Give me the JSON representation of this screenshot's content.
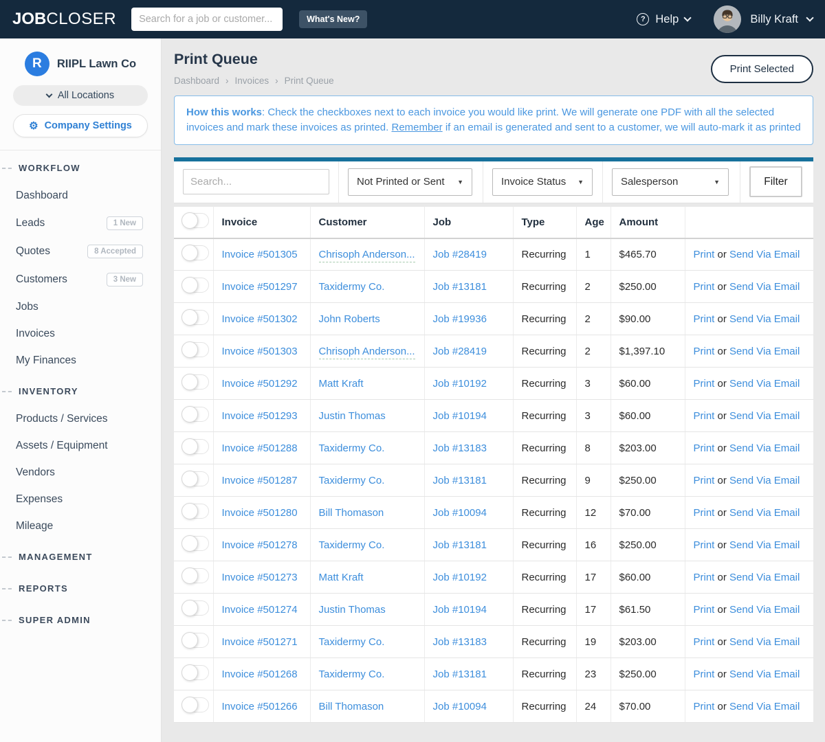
{
  "navbar": {
    "logo_bold": "JOB",
    "logo_light": "CLOSER",
    "search_placeholder": "Search for a job or customer...",
    "whats_new": "What's New?",
    "help": "Help",
    "help_icon_glyph": "?",
    "user_name": "Billy Kraft"
  },
  "sidebar": {
    "company": {
      "initial": "R",
      "name": "RIIPL Lawn Co"
    },
    "locations_label": "All Locations",
    "company_settings_label": "Company Settings",
    "gear_icon_glyph": "⚙",
    "sections": [
      {
        "label": "WORKFLOW",
        "items": [
          {
            "label": "Dashboard"
          },
          {
            "label": "Leads",
            "badge": "1 New"
          },
          {
            "label": "Quotes",
            "badge": "8 Accepted"
          },
          {
            "label": "Customers",
            "badge": "3 New"
          },
          {
            "label": "Jobs"
          },
          {
            "label": "Invoices"
          },
          {
            "label": "My Finances"
          }
        ]
      },
      {
        "label": "INVENTORY",
        "items": [
          {
            "label": "Products / Services"
          },
          {
            "label": "Assets / Equipment"
          },
          {
            "label": "Vendors"
          },
          {
            "label": "Expenses"
          },
          {
            "label": "Mileage"
          }
        ]
      },
      {
        "label": "MANAGEMENT",
        "items": []
      },
      {
        "label": "REPORTS",
        "items": []
      },
      {
        "label": "SUPER ADMIN",
        "items": []
      }
    ]
  },
  "header": {
    "title": "Print Queue",
    "breadcrumb": [
      "Dashboard",
      "Invoices",
      "Print Queue"
    ],
    "print_selected_label": "Print Selected"
  },
  "info_box": {
    "bold": "How this works",
    "text_1": ": Check the checkboxes next to each invoice you would like print. We will generate one PDF with all the selected invoices and mark these invoices as printed. ",
    "underline": "Remember",
    "text_2": " if an email is generated and sent to a customer, we will auto-mark it as printed"
  },
  "filters": {
    "search_placeholder": "Search...",
    "selects": [
      "Not Printed or Sent",
      "Invoice Status",
      "Salesperson"
    ],
    "caret_glyph": "▼",
    "filter_button_label": "Filter"
  },
  "table": {
    "columns": [
      "Invoice",
      "Customer",
      "Job",
      "Type",
      "Age",
      "Amount"
    ],
    "action_print": "Print",
    "action_or": "or",
    "action_email": "Send Via Email",
    "rows": [
      {
        "invoice": "Invoice #501305",
        "customer": "Chrisoph Anderson...",
        "job": "Job #28419",
        "type": "Recurring",
        "age": "1",
        "amount": "$465.70"
      },
      {
        "invoice": "Invoice #501297",
        "customer": "Taxidermy Co.",
        "job": "Job #13181",
        "type": "Recurring",
        "age": "2",
        "amount": "$250.00"
      },
      {
        "invoice": "Invoice #501302",
        "customer": "John Roberts",
        "job": "Job #19936",
        "type": "Recurring",
        "age": "2",
        "amount": "$90.00"
      },
      {
        "invoice": "Invoice #501303",
        "customer": "Chrisoph Anderson...",
        "job": "Job #28419",
        "type": "Recurring",
        "age": "2",
        "amount": "$1,397.10"
      },
      {
        "invoice": "Invoice #501292",
        "customer": "Matt Kraft",
        "job": "Job #10192",
        "type": "Recurring",
        "age": "3",
        "amount": "$60.00"
      },
      {
        "invoice": "Invoice #501293",
        "customer": "Justin Thomas",
        "job": "Job #10194",
        "type": "Recurring",
        "age": "3",
        "amount": "$60.00"
      },
      {
        "invoice": "Invoice #501288",
        "customer": "Taxidermy Co.",
        "job": "Job #13183",
        "type": "Recurring",
        "age": "8",
        "amount": "$203.00"
      },
      {
        "invoice": "Invoice #501287",
        "customer": "Taxidermy Co.",
        "job": "Job #13181",
        "type": "Recurring",
        "age": "9",
        "amount": "$250.00"
      },
      {
        "invoice": "Invoice #501280",
        "customer": "Bill Thomason",
        "job": "Job #10094",
        "type": "Recurring",
        "age": "12",
        "amount": "$70.00"
      },
      {
        "invoice": "Invoice #501278",
        "customer": "Taxidermy Co.",
        "job": "Job #13181",
        "type": "Recurring",
        "age": "16",
        "amount": "$250.00"
      },
      {
        "invoice": "Invoice #501273",
        "customer": "Matt Kraft",
        "job": "Job #10192",
        "type": "Recurring",
        "age": "17",
        "amount": "$60.00"
      },
      {
        "invoice": "Invoice #501274",
        "customer": "Justin Thomas",
        "job": "Job #10194",
        "type": "Recurring",
        "age": "17",
        "amount": "$61.50"
      },
      {
        "invoice": "Invoice #501271",
        "customer": "Taxidermy Co.",
        "job": "Job #13183",
        "type": "Recurring",
        "age": "19",
        "amount": "$203.00"
      },
      {
        "invoice": "Invoice #501268",
        "customer": "Taxidermy Co.",
        "job": "Job #13181",
        "type": "Recurring",
        "age": "23",
        "amount": "$250.00"
      },
      {
        "invoice": "Invoice #501266",
        "customer": "Bill Thomason",
        "job": "Job #10094",
        "type": "Recurring",
        "age": "24",
        "amount": "$70.00"
      }
    ]
  },
  "colors": {
    "navbar_navy": "#14293d",
    "accent_link_blue": "#3d8edc",
    "info_blue": "#4a97e0",
    "panel_teal": "#17719c",
    "company_logo_blue": "#2b7de0"
  }
}
